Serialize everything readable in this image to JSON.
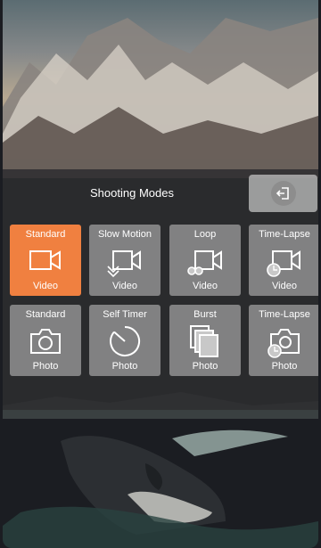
{
  "panel": {
    "title": "Shooting Modes",
    "back_icon": "exit-arrow-icon"
  },
  "modes": [
    {
      "top": "Standard",
      "bottom": "Video",
      "icon": "video-camera-icon",
      "active": true
    },
    {
      "top": "Slow Motion",
      "bottom": "Video",
      "icon": "slow-motion-video-icon",
      "active": false
    },
    {
      "top": "Loop",
      "bottom": "Video",
      "icon": "loop-video-icon",
      "active": false
    },
    {
      "top": "Time-Lapse",
      "bottom": "Video",
      "icon": "timelapse-video-icon",
      "active": false
    },
    {
      "top": "Standard",
      "bottom": "Photo",
      "icon": "camera-icon",
      "active": false
    },
    {
      "top": "Self Timer",
      "bottom": "Photo",
      "icon": "self-timer-icon",
      "active": false
    },
    {
      "top": "Burst",
      "bottom": "Photo",
      "icon": "burst-photo-icon",
      "active": false
    },
    {
      "top": "Time-Lapse",
      "bottom": "Photo",
      "icon": "timelapse-photo-icon",
      "active": false
    }
  ],
  "colors": {
    "active": "#f08040",
    "tile": "#c8c8c8"
  }
}
